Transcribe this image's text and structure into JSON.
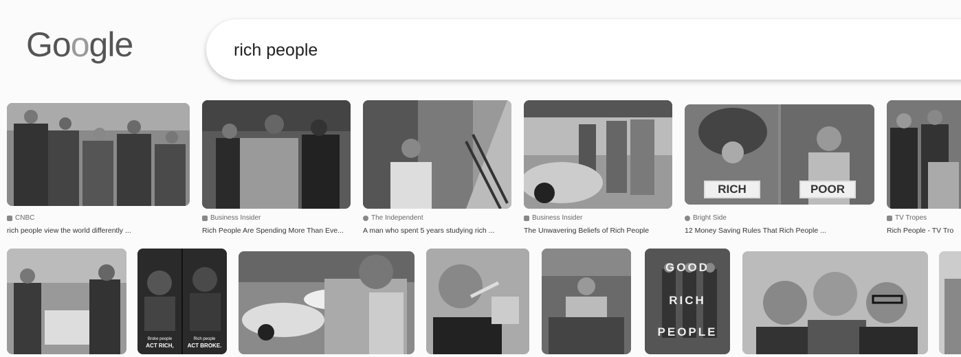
{
  "logo": {
    "text": "Google"
  },
  "search": {
    "query": "rich people"
  },
  "results_row1": [
    {
      "source": "CNBC",
      "caption": "rich people view the world differently ..."
    },
    {
      "source": "Business Insider",
      "caption": "Rich People Are Spending More Than Eve..."
    },
    {
      "source": "The Independent",
      "caption": "A man who spent 5 years studying rich ..."
    },
    {
      "source": "Business Insider",
      "caption": "The Unwavering Beliefs of Rich People"
    },
    {
      "source": "Bright Side",
      "caption": "12 Money Saving Rules That Rich People ..."
    },
    {
      "source": "TV Tropes",
      "caption": "Rich People - TV Tro"
    }
  ],
  "image_text": {
    "rich_label": "RICH",
    "poor_label": "POOR",
    "act_rich": "ACT RICH,",
    "act_broke": "ACT BROKE.",
    "broke_people": "Broke people",
    "rich_people_small": "Rich people",
    "good": "GOOD",
    "rich": "RICH",
    "people": "PEOPLE"
  }
}
